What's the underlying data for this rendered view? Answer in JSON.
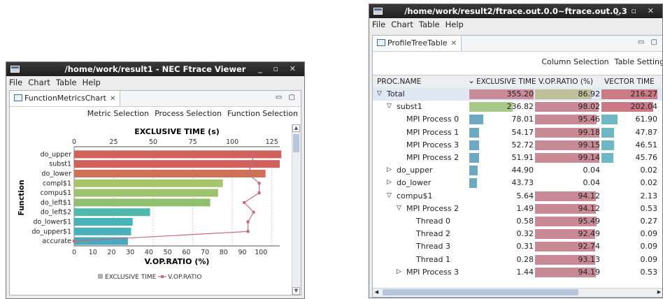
{
  "left_window": {
    "title": "/home/work/result1 - NEC Ftrace Viewer",
    "menu": [
      "File",
      "Chart",
      "Table",
      "Help"
    ],
    "tab_label": "FunctionMetricsChart",
    "actions": [
      "Metric Selection",
      "Process Selection",
      "Function Selection"
    ],
    "chart_data": {
      "type": "bar",
      "top_axis_label": "EXCLUSIVE TIME (s)",
      "bottom_axis_label": "V.OP.RATIO (%)",
      "ylabel": "Function",
      "categories": [
        "do_upper",
        "subst1",
        "do_lower",
        "compl$1",
        "compu$1",
        "do_left$1",
        "do_left$2",
        "do_lower$1",
        "do_upper$1",
        "accurate"
      ],
      "top_xlim": [
        0,
        130
      ],
      "top_ticks": [
        0,
        25,
        50,
        75,
        100,
        125
      ],
      "bottom_xlim": [
        0,
        110
      ],
      "bottom_ticks": [
        0,
        10,
        20,
        30,
        40,
        50,
        60,
        70,
        80,
        90,
        100
      ],
      "series": [
        {
          "name": "EXCLUSIVE TIME",
          "kind": "bar",
          "values": [
            131,
            130,
            121,
            94,
            91,
            86,
            48,
            37,
            36,
            34
          ]
        },
        {
          "name": "V.OP.RATIO",
          "kind": "line",
          "values": [
            96,
            95,
            93,
            99,
            99,
            91,
            96,
            93,
            93,
            0
          ]
        }
      ],
      "bar_colors": [
        "#d0605c",
        "#d0605c",
        "#cf7156",
        "#a6c46a",
        "#9cc26e",
        "#8fbf6f",
        "#4fb9a9",
        "#48b3b6",
        "#48b0b8",
        "#4aa9bd"
      ],
      "line_color": "#c56a76",
      "legend": [
        "EXCLUSIVE TIME",
        "V.OP.RATIO"
      ]
    }
  },
  "right_window": {
    "title": "/home/work/result2/ftrace.out.0.0~ftrace.out.0.3",
    "menu": [
      "File",
      "Chart",
      "Table",
      "Help"
    ],
    "tab_label": "ProfileTreeTable",
    "actions": [
      "Column Selection",
      "Table Setting"
    ],
    "columns": [
      "PROC.NAME",
      "EXCLUSIVE TIME",
      "V.OP.RATIO (%)",
      "VECTOR TIME"
    ],
    "sort_indicator": "⌄",
    "rows": [
      {
        "depth": 0,
        "toggle": "▽",
        "name": "Total",
        "ex": "355.20",
        "vop": "86.92",
        "vt": "216.27",
        "exb": 1.0,
        "vopb": 0.87,
        "vtb": 1.0,
        "exc": "#c98a9a",
        "vopc": "#bfbf9a",
        "vtc": "#c97a85"
      },
      {
        "depth": 1,
        "toggle": "▽",
        "name": "subst1",
        "ex": "236.82",
        "vop": "98.02",
        "vt": "202.04",
        "exb": 0.67,
        "vopb": 0.98,
        "vtb": 0.93,
        "exc": "#a8c98a",
        "vopc": "#c98a95",
        "vtc": "#c97a85"
      },
      {
        "depth": 2,
        "toggle": "",
        "name": "MPI Process 0",
        "ex": "78.01",
        "vop": "95.46",
        "vt": "61.90",
        "exb": 0.22,
        "vopb": 0.95,
        "vtb": 0.29,
        "exc": "#6da8c4",
        "vopc": "#c98a95",
        "vtc": "#6db8c4"
      },
      {
        "depth": 2,
        "toggle": "",
        "name": "MPI Process 1",
        "ex": "54.17",
        "vop": "99.18",
        "vt": "47.87",
        "exb": 0.15,
        "vopb": 0.99,
        "vtb": 0.22,
        "exc": "#6da8c4",
        "vopc": "#c98a95",
        "vtc": "#6db8c4"
      },
      {
        "depth": 2,
        "toggle": "",
        "name": "MPI Process 3",
        "ex": "52.72",
        "vop": "99.15",
        "vt": "46.51",
        "exb": 0.15,
        "vopb": 0.99,
        "vtb": 0.22,
        "exc": "#6da8c4",
        "vopc": "#c98a95",
        "vtc": "#6db8c4"
      },
      {
        "depth": 2,
        "toggle": "",
        "name": "MPI Process 2",
        "ex": "51.91",
        "vop": "99.14",
        "vt": "45.76",
        "exb": 0.15,
        "vopb": 0.99,
        "vtb": 0.21,
        "exc": "#6da8c4",
        "vopc": "#c98a95",
        "vtc": "#6db8c4"
      },
      {
        "depth": 1,
        "toggle": "▷",
        "name": "do_upper",
        "ex": "44.90",
        "vop": "0.04",
        "vt": "0.02",
        "exb": 0.13,
        "vopb": 0.0,
        "vtb": 0.0,
        "exc": "#6da8c4",
        "vopc": "#c98a95",
        "vtc": "#6db8c4"
      },
      {
        "depth": 1,
        "toggle": "▷",
        "name": "do_lower",
        "ex": "43.73",
        "vop": "0.04",
        "vt": "0.02",
        "exb": 0.12,
        "vopb": 0.0,
        "vtb": 0.0,
        "exc": "#6da8c4",
        "vopc": "#c98a95",
        "vtc": "#6db8c4"
      },
      {
        "depth": 1,
        "toggle": "▽",
        "name": "compu$1",
        "ex": "5.64",
        "vop": "94.12",
        "vt": "2.13",
        "exb": 0.0,
        "vopb": 0.94,
        "vtb": 0.0,
        "exc": "#6da8c4",
        "vopc": "#c98a95",
        "vtc": "#6db8c4"
      },
      {
        "depth": 2,
        "toggle": "▽",
        "name": "MPI Process 2",
        "ex": "1.49",
        "vop": "94.12",
        "vt": "0.53",
        "exb": 0.0,
        "vopb": 0.94,
        "vtb": 0.0,
        "exc": "#6da8c4",
        "vopc": "#c98a95",
        "vtc": "#6db8c4"
      },
      {
        "depth": 3,
        "toggle": "",
        "name": "Thread 0",
        "ex": "0.58",
        "vop": "95.49",
        "vt": "0.27",
        "exb": 0.0,
        "vopb": 0.95,
        "vtb": 0.0,
        "exc": "#6da8c4",
        "vopc": "#c98a95",
        "vtc": "#6db8c4"
      },
      {
        "depth": 3,
        "toggle": "",
        "name": "Thread 2",
        "ex": "0.32",
        "vop": "92.49",
        "vt": "0.09",
        "exb": 0.0,
        "vopb": 0.92,
        "vtb": 0.0,
        "exc": "#6da8c4",
        "vopc": "#c98a95",
        "vtc": "#6db8c4"
      },
      {
        "depth": 3,
        "toggle": "",
        "name": "Thread 3",
        "ex": "0.31",
        "vop": "92.74",
        "vt": "0.09",
        "exb": 0.0,
        "vopb": 0.93,
        "vtb": 0.0,
        "exc": "#6da8c4",
        "vopc": "#c98a95",
        "vtc": "#6db8c4"
      },
      {
        "depth": 3,
        "toggle": "",
        "name": "Thread 1",
        "ex": "0.28",
        "vop": "93.13",
        "vt": "0.09",
        "exb": 0.0,
        "vopb": 0.93,
        "vtb": 0.0,
        "exc": "#6da8c4",
        "vopc": "#c98a95",
        "vtc": "#6db8c4"
      },
      {
        "depth": 2,
        "toggle": "▷",
        "name": "MPI Process 3",
        "ex": "1.44",
        "vop": "94.19",
        "vt": "0.53",
        "exb": 0.0,
        "vopb": 0.94,
        "vtb": 0.0,
        "exc": "#6da8c4",
        "vopc": "#c98a95",
        "vtc": "#6db8c4"
      }
    ]
  }
}
